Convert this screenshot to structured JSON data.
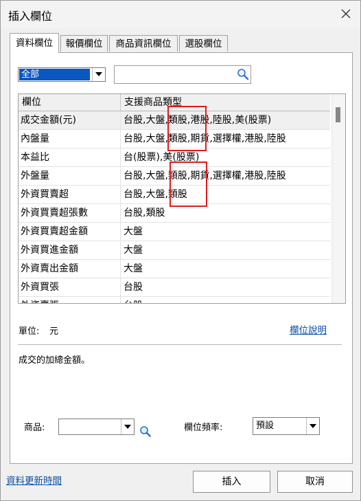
{
  "window": {
    "title": "插入欄位"
  },
  "tabs": [
    {
      "label": "資料欄位",
      "active": true
    },
    {
      "label": "報價欄位",
      "active": false
    },
    {
      "label": "商品資訊欄位",
      "active": false
    },
    {
      "label": "選股欄位",
      "active": false
    }
  ],
  "filter": {
    "category": "全部",
    "search_value": ""
  },
  "grid": {
    "headers": [
      "欄位",
      "支援商品類型"
    ],
    "rows": [
      {
        "field": "成交金額(元)",
        "types": "台股,大盤,類股,港股,陸股,美(股票)",
        "selected": true
      },
      {
        "field": "內盤量",
        "types": "台股,大盤,類股,期貨,選擇權,港股,陸股"
      },
      {
        "field": "本益比",
        "types": "台(股票),美(股票)"
      },
      {
        "field": "外盤量",
        "types": "台股,大盤,類股,期貨,選擇權,港股,陸股"
      },
      {
        "field": "外資買賣超",
        "types": "台股,大盤,類股"
      },
      {
        "field": "外資買賣超張數",
        "types": "台股,類股"
      },
      {
        "field": "外資買賣超金額",
        "types": "大盤"
      },
      {
        "field": "外資買進金額",
        "types": "大盤"
      },
      {
        "field": "外資賣出金額",
        "types": "大盤"
      },
      {
        "field": "外資買張",
        "types": "台股"
      },
      {
        "field": "外資賣張",
        "types": "台股"
      }
    ]
  },
  "info": {
    "unit_label": "單位:",
    "unit_value": "元",
    "help_link": "欄位說明",
    "description": "成交的加總金額。"
  },
  "options": {
    "product_label": "商品:",
    "product_value": "",
    "frequency_label": "欄位頻率:",
    "frequency_value": "預設"
  },
  "footer": {
    "update_link": "資料更新時間",
    "insert_button": "插入",
    "cancel_button": "取消"
  },
  "colors": {
    "selection": "#0a57c0",
    "link": "#0b4fa0",
    "highlight_box": "#e01b1b"
  },
  "icons": [
    "close-icon",
    "dropdown-arrow-icon",
    "search-icon",
    "magnifier-icon"
  ]
}
